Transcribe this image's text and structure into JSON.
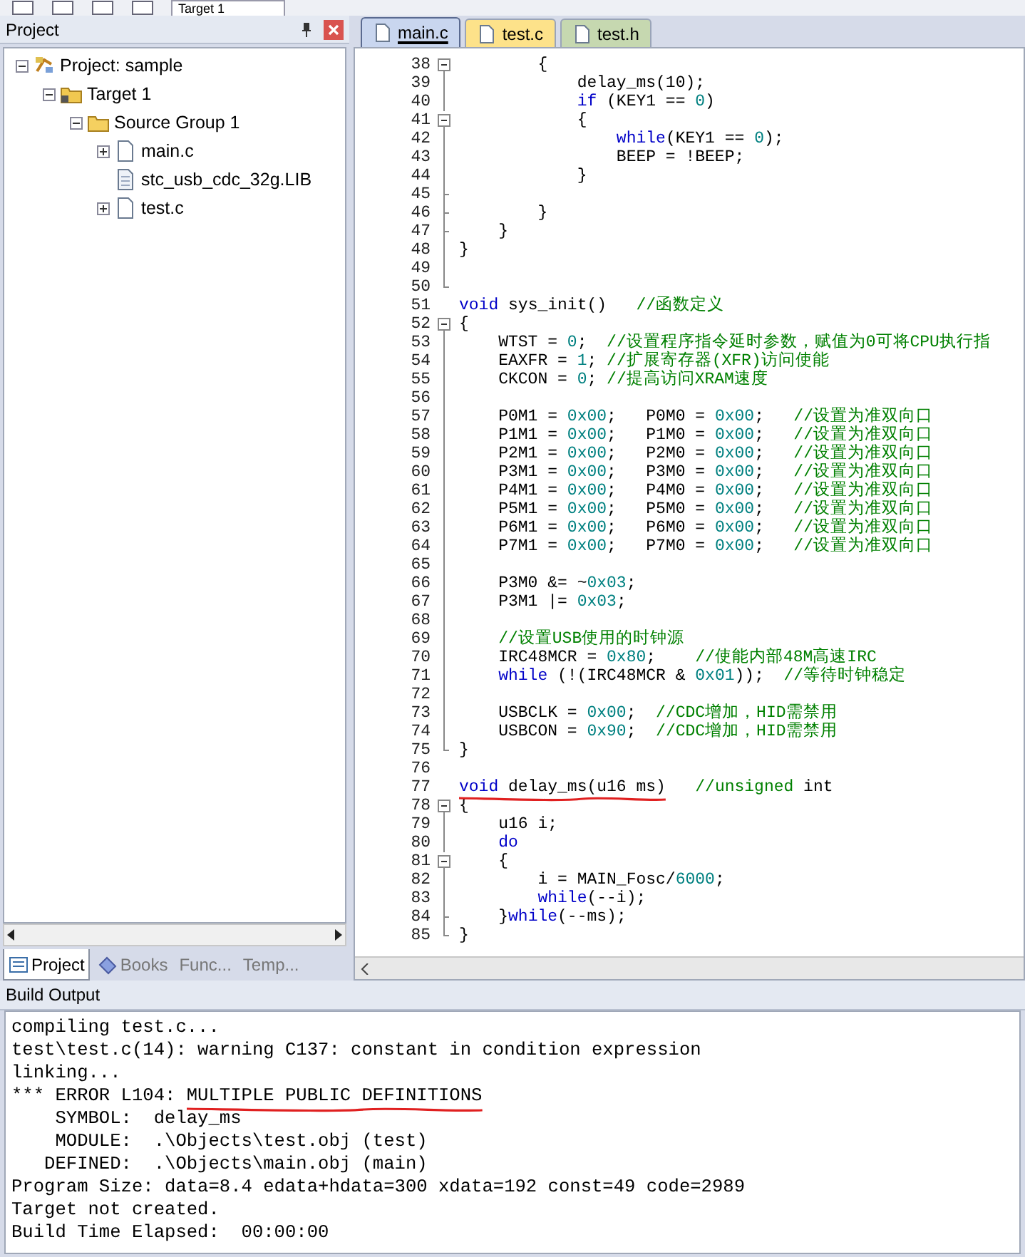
{
  "toolbar": {
    "target": "Target 1"
  },
  "project_panel": {
    "title": "Project",
    "tree": [
      {
        "label": "Project: sample",
        "kind": "project",
        "expanded": true,
        "children": [
          {
            "label": "Target 1",
            "kind": "target",
            "expanded": true,
            "children": [
              {
                "label": "Source Group 1",
                "kind": "group",
                "expanded": true,
                "children": [
                  {
                    "label": "main.c",
                    "kind": "file",
                    "expanded": false
                  },
                  {
                    "label": "stc_usb_cdc_32g.LIB",
                    "kind": "lib"
                  },
                  {
                    "label": "test.c",
                    "kind": "file",
                    "expanded": false
                  }
                ]
              }
            ]
          }
        ]
      }
    ],
    "tabs": [
      {
        "label": "Project",
        "kind": "project",
        "selected": true
      },
      {
        "label": "Books",
        "kind": "books",
        "selected": false
      },
      {
        "label": "Func...",
        "kind": "functions",
        "selected": false
      },
      {
        "label": "Temp...",
        "kind": "templates",
        "selected": false
      }
    ]
  },
  "editor": {
    "tabs": [
      {
        "label": "main.c",
        "selected": true,
        "color": "#c9d6ef"
      },
      {
        "label": "test.c",
        "selected": false,
        "color": "#fde28a"
      },
      {
        "label": "test.h",
        "selected": false,
        "color": "#c6d8b0"
      }
    ],
    "lines": [
      {
        "number": "38",
        "kind": "fold-start",
        "segments": [
          {
            "kind": "plain",
            "text": "        {"
          }
        ]
      },
      {
        "number": "39",
        "kind": "fold-body",
        "segments": [
          {
            "kind": "plain",
            "text": "            delay_ms(10);"
          }
        ]
      },
      {
        "number": "40",
        "kind": "fold-body",
        "segments": [
          {
            "kind": "keyword",
            "text": "            if"
          },
          {
            "kind": "plain",
            "text": " (KEY1 == "
          },
          {
            "kind": "number",
            "text": "0"
          },
          {
            "kind": "plain",
            "text": ")"
          }
        ]
      },
      {
        "number": "41",
        "kind": "fold-start",
        "segments": [
          {
            "kind": "plain",
            "text": "            {"
          }
        ]
      },
      {
        "number": "42",
        "kind": "fold-body",
        "segments": [
          {
            "kind": "keyword",
            "text": "                while"
          },
          {
            "kind": "plain",
            "text": "(KEY1 == "
          },
          {
            "kind": "number",
            "text": "0"
          },
          {
            "kind": "plain",
            "text": ");"
          }
        ]
      },
      {
        "number": "43",
        "kind": "fold-body",
        "segments": [
          {
            "kind": "plain",
            "text": "                BEEP = !BEEP;"
          }
        ]
      },
      {
        "number": "44",
        "kind": "fold-body",
        "segments": [
          {
            "kind": "plain",
            "text": "            }"
          }
        ]
      },
      {
        "number": "45",
        "kind": "fold-branch"
      },
      {
        "number": "46",
        "kind": "fold-branch",
        "segments": [
          {
            "kind": "plain",
            "text": "        }"
          }
        ]
      },
      {
        "number": "47",
        "kind": "fold-branch",
        "segments": [
          {
            "kind": "plain",
            "text": "    }"
          }
        ]
      },
      {
        "number": "48",
        "kind": "fold-body",
        "segments": [
          {
            "kind": "plain",
            "text": "}"
          }
        ]
      },
      {
        "number": "49",
        "kind": "fold-body"
      },
      {
        "number": "50",
        "kind": "fold-end"
      },
      {
        "number": "51",
        "kind": "plain",
        "segments": [
          {
            "kind": "keyword",
            "text": "void"
          },
          {
            "kind": "plain",
            "text": " sys_init()   "
          },
          {
            "kind": "comment",
            "text": "//函数定义"
          }
        ]
      },
      {
        "number": "52",
        "kind": "fold-start",
        "segments": [
          {
            "kind": "plain",
            "text": "{"
          }
        ]
      },
      {
        "number": "53",
        "kind": "fold-body",
        "segments": [
          {
            "kind": "plain",
            "text": "    WTST = "
          },
          {
            "kind": "number",
            "text": "0"
          },
          {
            "kind": "plain",
            "text": ";  "
          },
          {
            "kind": "comment",
            "text": "//设置程序指令延时参数，赋值为0可将CPU执行指"
          }
        ]
      },
      {
        "number": "54",
        "kind": "fold-body",
        "segments": [
          {
            "kind": "plain",
            "text": "    EAXFR = "
          },
          {
            "kind": "number",
            "text": "1"
          },
          {
            "kind": "plain",
            "text": "; "
          },
          {
            "kind": "comment",
            "text": "//扩展寄存器(XFR)访问使能"
          }
        ]
      },
      {
        "number": "55",
        "kind": "fold-body",
        "segments": [
          {
            "kind": "plain",
            "text": "    CKCON = "
          },
          {
            "kind": "number",
            "text": "0"
          },
          {
            "kind": "plain",
            "text": "; "
          },
          {
            "kind": "comment",
            "text": "//提高访问XRAM速度"
          }
        ]
      },
      {
        "number": "56",
        "kind": "fold-body"
      },
      {
        "number": "57",
        "kind": "fold-body",
        "segments": [
          {
            "kind": "plain",
            "text": "    P0M1 = "
          },
          {
            "kind": "number",
            "text": "0x00"
          },
          {
            "kind": "plain",
            "text": ";   P0M0 = "
          },
          {
            "kind": "number",
            "text": "0x00"
          },
          {
            "kind": "plain",
            "text": ";   "
          },
          {
            "kind": "comment",
            "text": "//设置为准双向口"
          }
        ]
      },
      {
        "number": "58",
        "kind": "fold-body",
        "segments": [
          {
            "kind": "plain",
            "text": "    P1M1 = "
          },
          {
            "kind": "number",
            "text": "0x00"
          },
          {
            "kind": "plain",
            "text": ";   P1M0 = "
          },
          {
            "kind": "number",
            "text": "0x00"
          },
          {
            "kind": "plain",
            "text": ";   "
          },
          {
            "kind": "comment",
            "text": "//设置为准双向口"
          }
        ]
      },
      {
        "number": "59",
        "kind": "fold-body",
        "segments": [
          {
            "kind": "plain",
            "text": "    P2M1 = "
          },
          {
            "kind": "number",
            "text": "0x00"
          },
          {
            "kind": "plain",
            "text": ";   P2M0 = "
          },
          {
            "kind": "number",
            "text": "0x00"
          },
          {
            "kind": "plain",
            "text": ";   "
          },
          {
            "kind": "comment",
            "text": "//设置为准双向口"
          }
        ]
      },
      {
        "number": "60",
        "kind": "fold-body",
        "segments": [
          {
            "kind": "plain",
            "text": "    P3M1 = "
          },
          {
            "kind": "number",
            "text": "0x00"
          },
          {
            "kind": "plain",
            "text": ";   P3M0 = "
          },
          {
            "kind": "number",
            "text": "0x00"
          },
          {
            "kind": "plain",
            "text": ";   "
          },
          {
            "kind": "comment",
            "text": "//设置为准双向口"
          }
        ]
      },
      {
        "number": "61",
        "kind": "fold-body",
        "segments": [
          {
            "kind": "plain",
            "text": "    P4M1 = "
          },
          {
            "kind": "number",
            "text": "0x00"
          },
          {
            "kind": "plain",
            "text": ";   P4M0 = "
          },
          {
            "kind": "number",
            "text": "0x00"
          },
          {
            "kind": "plain",
            "text": ";   "
          },
          {
            "kind": "comment",
            "text": "//设置为准双向口"
          }
        ]
      },
      {
        "number": "62",
        "kind": "fold-body",
        "segments": [
          {
            "kind": "plain",
            "text": "    P5M1 = "
          },
          {
            "kind": "number",
            "text": "0x00"
          },
          {
            "kind": "plain",
            "text": ";   P5M0 = "
          },
          {
            "kind": "number",
            "text": "0x00"
          },
          {
            "kind": "plain",
            "text": ";   "
          },
          {
            "kind": "comment",
            "text": "//设置为准双向口"
          }
        ]
      },
      {
        "number": "63",
        "kind": "fold-body",
        "segments": [
          {
            "kind": "plain",
            "text": "    P6M1 = "
          },
          {
            "kind": "number",
            "text": "0x00"
          },
          {
            "kind": "plain",
            "text": ";   P6M0 = "
          },
          {
            "kind": "number",
            "text": "0x00"
          },
          {
            "kind": "plain",
            "text": ";   "
          },
          {
            "kind": "comment",
            "text": "//设置为准双向口"
          }
        ]
      },
      {
        "number": "64",
        "kind": "fold-body",
        "segments": [
          {
            "kind": "plain",
            "text": "    P7M1 = "
          },
          {
            "kind": "number",
            "text": "0x00"
          },
          {
            "kind": "plain",
            "text": ";   P7M0 = "
          },
          {
            "kind": "number",
            "text": "0x00"
          },
          {
            "kind": "plain",
            "text": ";   "
          },
          {
            "kind": "comment",
            "text": "//设置为准双向口"
          }
        ]
      },
      {
        "number": "65",
        "kind": "fold-body"
      },
      {
        "number": "66",
        "kind": "fold-body",
        "segments": [
          {
            "kind": "plain",
            "text": "    P3M0 &= ~"
          },
          {
            "kind": "number",
            "text": "0x03"
          },
          {
            "kind": "plain",
            "text": ";"
          }
        ]
      },
      {
        "number": "67",
        "kind": "fold-body",
        "segments": [
          {
            "kind": "plain",
            "text": "    P3M1 |= "
          },
          {
            "kind": "number",
            "text": "0x03"
          },
          {
            "kind": "plain",
            "text": ";"
          }
        ]
      },
      {
        "number": "68",
        "kind": "fold-body"
      },
      {
        "number": "69",
        "kind": "fold-body",
        "segments": [
          {
            "kind": "comment",
            "text": "    //设置USB使用的时钟源"
          }
        ]
      },
      {
        "number": "70",
        "kind": "fold-body",
        "segments": [
          {
            "kind": "plain",
            "text": "    IRC48MCR = "
          },
          {
            "kind": "number",
            "text": "0x80"
          },
          {
            "kind": "plain",
            "text": ";    "
          },
          {
            "kind": "comment",
            "text": "//使能内部48M高速IRC"
          }
        ]
      },
      {
        "number": "71",
        "kind": "fold-body",
        "segments": [
          {
            "kind": "keyword",
            "text": "    while"
          },
          {
            "kind": "plain",
            "text": " (!(IRC48MCR & "
          },
          {
            "kind": "number",
            "text": "0x01"
          },
          {
            "kind": "plain",
            "text": "));  "
          },
          {
            "kind": "comment",
            "text": "//等待时钟稳定"
          }
        ]
      },
      {
        "number": "72",
        "kind": "fold-body"
      },
      {
        "number": "73",
        "kind": "fold-body",
        "segments": [
          {
            "kind": "plain",
            "text": "    USBCLK = "
          },
          {
            "kind": "number",
            "text": "0x00"
          },
          {
            "kind": "plain",
            "text": ";  "
          },
          {
            "kind": "comment",
            "text": "//CDC增加，HID需禁用"
          }
        ]
      },
      {
        "number": "74",
        "kind": "fold-body",
        "segments": [
          {
            "kind": "plain",
            "text": "    USBCON = "
          },
          {
            "kind": "number",
            "text": "0x90"
          },
          {
            "kind": "plain",
            "text": ";  "
          },
          {
            "kind": "comment",
            "text": "//CDC增加，HID需禁用"
          }
        ]
      },
      {
        "number": "75",
        "kind": "fold-end",
        "segments": [
          {
            "kind": "plain",
            "text": "}"
          }
        ]
      },
      {
        "number": "76",
        "kind": "plain"
      },
      {
        "number": "77",
        "kind": "plain",
        "segments": [
          {
            "kind": "keyword",
            "text": "void",
            "marked": true
          },
          {
            "kind": "plain",
            "text": " delay_ms(u16 ms)",
            "marked": true
          },
          {
            "kind": "comment",
            "text": "   //unsigned"
          },
          {
            "kind": "plain",
            "text": " int"
          }
        ]
      },
      {
        "number": "78",
        "kind": "fold-start",
        "segments": [
          {
            "kind": "plain",
            "text": "{"
          }
        ]
      },
      {
        "number": "79",
        "kind": "fold-body",
        "segments": [
          {
            "kind": "plain",
            "text": "    u16 i;"
          }
        ]
      },
      {
        "number": "80",
        "kind": "fold-body",
        "segments": [
          {
            "kind": "keyword",
            "text": "    do"
          }
        ]
      },
      {
        "number": "81",
        "kind": "fold-start",
        "segments": [
          {
            "kind": "plain",
            "text": "    {"
          }
        ]
      },
      {
        "number": "82",
        "kind": "fold-body",
        "segments": [
          {
            "kind": "plain",
            "text": "        i = MAIN_Fosc/"
          },
          {
            "kind": "number",
            "text": "6000"
          },
          {
            "kind": "plain",
            "text": ";"
          }
        ]
      },
      {
        "number": "83",
        "kind": "fold-body",
        "segments": [
          {
            "kind": "keyword",
            "text": "        while"
          },
          {
            "kind": "plain",
            "text": "(--i);"
          }
        ]
      },
      {
        "number": "84",
        "kind": "fold-branch",
        "segments": [
          {
            "kind": "plain",
            "text": "    }"
          },
          {
            "kind": "keyword",
            "text": "while"
          },
          {
            "kind": "plain",
            "text": "(--ms);"
          }
        ]
      },
      {
        "number": "85",
        "kind": "fold-end",
        "segments": [
          {
            "kind": "plain",
            "text": "}"
          }
        ]
      }
    ]
  },
  "build_output": {
    "title": "Build Output",
    "lines": [
      {
        "segments": [
          {
            "text": "compiling test.c..."
          }
        ]
      },
      {
        "segments": [
          {
            "text": "test\\test.c(14): warning C137: constant in condition expression"
          }
        ]
      },
      {
        "segments": [
          {
            "text": "linking..."
          }
        ]
      },
      {
        "segments": [
          {
            "text": "*** ERROR L104: "
          },
          {
            "text": "MULTIPLE PUBLIC DEFINITIONS",
            "marked": true
          }
        ]
      },
      {
        "segments": [
          {
            "text": "    SYMBOL:  delay_ms"
          }
        ]
      },
      {
        "segments": [
          {
            "text": "    MODULE:  .\\Objects\\test.obj (test)"
          }
        ]
      },
      {
        "segments": [
          {
            "text": "   DEFINED:  .\\Objects\\main.obj (main)"
          }
        ]
      },
      {
        "segments": [
          {
            "text": "Program Size: data=8.4 edata+hdata=300 xdata=192 const=49 code=2989"
          }
        ]
      },
      {
        "segments": [
          {
            "text": "Target not created."
          }
        ]
      },
      {
        "segments": [
          {
            "text": "Build Time Elapsed:  00:00:00"
          }
        ]
      }
    ]
  }
}
